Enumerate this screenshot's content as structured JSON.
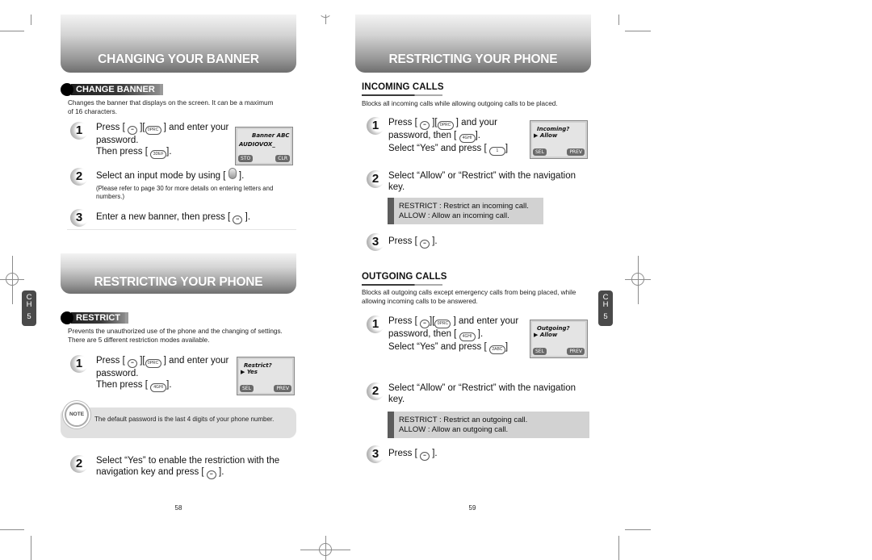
{
  "left_page": {
    "section1": {
      "banner_title": "CHANGING YOUR BANNER",
      "heading": "CHANGE BANNER",
      "description": "Changes the banner that displays on the screen. It can be a maximum of 16 characters.",
      "steps": [
        {
          "num": "1",
          "line1_a": "Press [",
          "line1_b": "][",
          "line1_c": "] and enter your",
          "line2": "password.",
          "line3_a": "Then press [",
          "line3_b": "]."
        },
        {
          "num": "2",
          "text_a": "Select an input mode by using [",
          "text_b": "].",
          "sub": "(Please refer to page 30 for more details on entering letters and numbers.)"
        },
        {
          "num": "3",
          "text_a": "Enter a new banner, then press [",
          "text_b": "]."
        }
      ],
      "screen": {
        "line1": "Banner   ABC",
        "line2": "AUDIOVOX_",
        "softkey_left": "STO",
        "softkey_right": "CLR"
      },
      "keys": {
        "ok": "••",
        "menu": "0PRC",
        "three": "3DEF"
      }
    },
    "section2": {
      "banner_title": "RESTRICTING YOUR PHONE",
      "heading": "RESTRICT",
      "description": "Prevents the unauthorized use of the phone and the changing of settings. There are 5 different restriction modes available.",
      "steps": [
        {
          "num": "1",
          "line1_a": "Press [",
          "line1_b": "][",
          "line1_c": "] and enter your",
          "line2": "password.",
          "line3_a": "Then press [",
          "line3_b": "]."
        },
        {
          "num": "2",
          "line1": "Select “Yes” to enable the restriction with the",
          "line2_a": "navigation key and press [",
          "line2_b": "]."
        }
      ],
      "screen": {
        "line1": "Restrict?",
        "line2": "▶ Yes",
        "softkey_left": "SEL",
        "softkey_right": "PREV"
      },
      "note_label": "NOTE",
      "note": "The default password is the last 4 digits of your phone number.",
      "keys": {
        "ok": "••",
        "menu": "0PRC",
        "four": "4GHI"
      }
    },
    "chapter_tab": {
      "letters": [
        "C",
        "H"
      ],
      "number": "5"
    },
    "page_number": "58"
  },
  "right_page": {
    "banner_title": "RESTRICTING YOUR PHONE",
    "incoming": {
      "title": "INCOMING CALLS",
      "description": "Blocks all incoming calls while allowing outgoing calls to be placed.",
      "steps": [
        {
          "num": "1",
          "line1_a": "Press [",
          "line1_b": "][",
          "line1_c": "] and your",
          "line2_a": "password, then [",
          "line2_b": "].",
          "line3_a": "Select “Yes” and press [",
          "line3_b": "]"
        },
        {
          "num": "2",
          "line1": "Select “Allow” or “Restrict” with the navigation",
          "line2": "key."
        },
        {
          "num": "3",
          "text_a": "Press [",
          "text_b": "]."
        }
      ],
      "info": [
        "RESTRICT : Restrict an incoming call.",
        "ALLOW : Allow an incoming call."
      ],
      "screen": {
        "line1": "Incoming?",
        "line2": "▶ Allow",
        "softkey_left": "SEL",
        "softkey_right": "PREV"
      },
      "keys": {
        "ok": "••",
        "menu": "0PRC",
        "four": "4GHI",
        "one": "1"
      }
    },
    "outgoing": {
      "title": "OUTGOING CALLS",
      "description": "Blocks all outgoing calls except emergency calls from being placed, while allowing incoming calls to be answered.",
      "steps": [
        {
          "num": "1",
          "line1_a": "Press [",
          "line1_b": "][",
          "line1_c": "] and enter your",
          "line2_a": "password, then [",
          "line2_b": "].",
          "line3_a": "Select “Yes” and press [",
          "line3_b": "]"
        },
        {
          "num": "2",
          "line1": "Select “Allow” or “Restrict” with the navigation",
          "line2": "key."
        },
        {
          "num": "3",
          "text_a": "Press [",
          "text_b": "]."
        }
      ],
      "info": [
        "RESTRICT : Restrict an outgoing call.",
        "ALLOW : Allow an outgoing call."
      ],
      "screen": {
        "line1": "Outgoing?",
        "line2": "▶ Allow",
        "softkey_left": "SEL",
        "softkey_right": "PREV"
      },
      "keys": {
        "ok": "••",
        "menu": "0PRC",
        "four": "4GHI",
        "two": "2ABC"
      }
    },
    "chapter_tab": {
      "letters": [
        "C",
        "H"
      ],
      "number": "5"
    },
    "page_number": "59"
  }
}
